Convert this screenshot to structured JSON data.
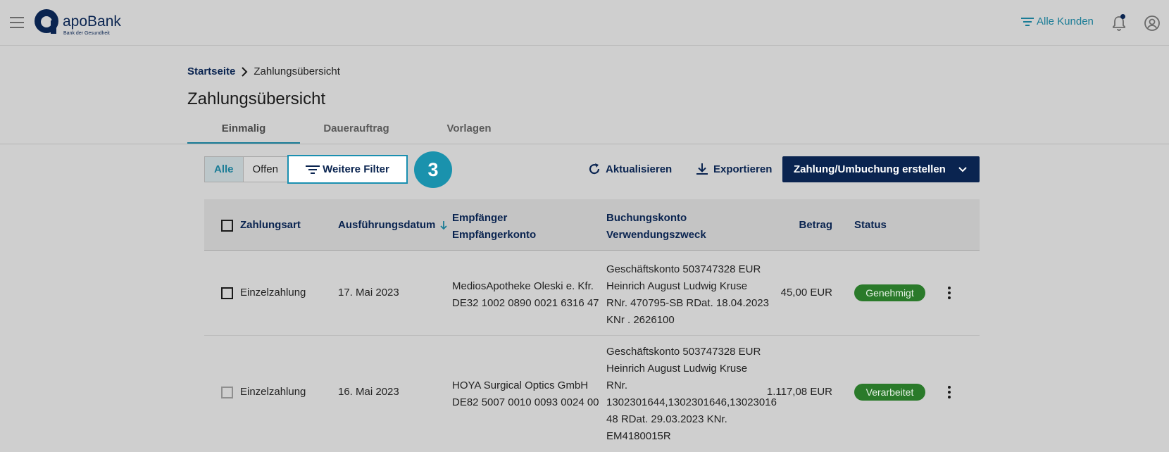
{
  "header": {
    "logo_text": "apoBank",
    "logo_subtext": "Bank der Gesundheit",
    "kunden_label": "Alle Kunden"
  },
  "breadcrumb": {
    "home": "Startseite",
    "current": "Zahlungsübersicht"
  },
  "page_title": "Zahlungsübersicht",
  "tabs": [
    {
      "label": "Einmalig",
      "active": true
    },
    {
      "label": "Dauerauftrag",
      "active": false
    },
    {
      "label": "Vorlagen",
      "active": false
    }
  ],
  "toolbar": {
    "seg_all": "Alle",
    "seg_open": "Offen",
    "filter_label": "Weitere Filter",
    "step_number": "3",
    "refresh_label": "Aktualisieren",
    "export_label": "Exportieren",
    "create_label": "Zahlung/Umbuchung erstellen"
  },
  "table": {
    "headers": {
      "type": "Zahlungsart",
      "date": "Ausführungsdatum",
      "recipient": "Empfänger",
      "recipient_account": "Empfängerkonto",
      "booking_account": "Buchungskonto",
      "purpose": "Verwendungszweck",
      "amount": "Betrag",
      "status": "Status"
    },
    "rows": [
      {
        "type": "Einzelzahlung",
        "date": "17. Mai 2023",
        "recipient": "MediosApotheke Oleski e. Kfr.",
        "iban": "DE32 1002 0890 0021 6316 47",
        "booking_lines": [
          "Geschäftskonto 503747328 EUR",
          "Heinrich August Ludwig Kruse",
          "RNr. 470795-SB RDat. 18.04.2023",
          "KNr . 2626100"
        ],
        "amount": "45,00 EUR",
        "status": "Genehmigt"
      },
      {
        "type": "Einzelzahlung",
        "date": "16. Mai 2023",
        "recipient": "HOYA Surgical Optics GmbH",
        "iban": "DE82 5007 0010 0093 0024 00",
        "booking_lines": [
          "Geschäftskonto 503747328 EUR",
          "Heinrich August Ludwig Kruse",
          "RNr.",
          "1302301644,1302301646,13023016",
          "48 RDat. 29.03.2023 KNr.",
          "EM4180015R"
        ],
        "amount": "1.117,08 EUR",
        "status": "Verarbeitet"
      }
    ]
  },
  "colors": {
    "brand_navy": "#0a2450",
    "accent_teal": "#1a7c96",
    "status_green": "#2a7a2a"
  }
}
